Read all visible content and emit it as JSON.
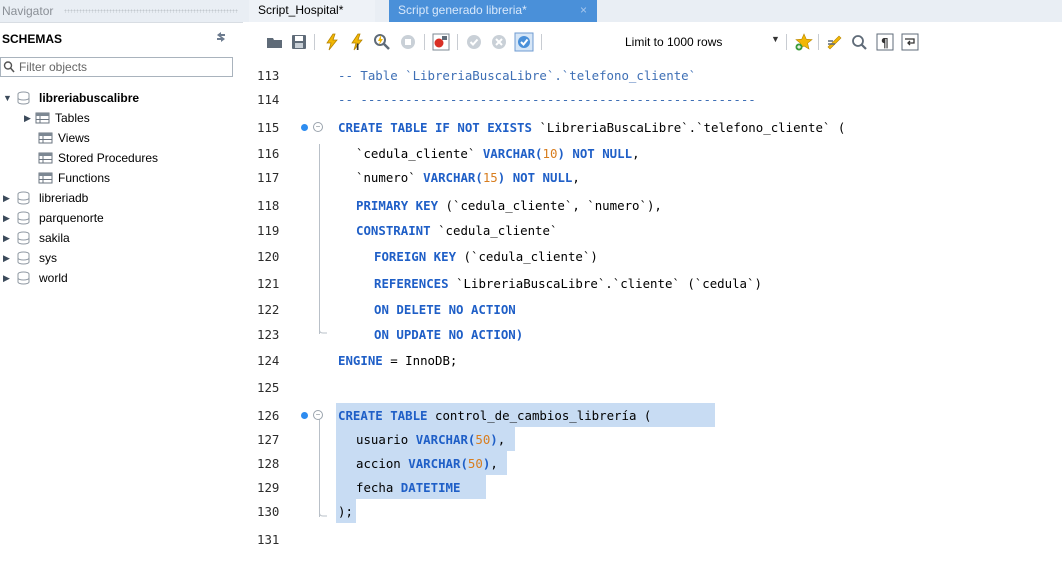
{
  "navigator": {
    "title": "Navigator",
    "schemas_label": "SCHEMAS",
    "filter_placeholder": "Filter objects",
    "tree": [
      {
        "label": "libreriabuscalibre",
        "expanded": true,
        "bold": true
      },
      {
        "label": "Tables"
      },
      {
        "label": "Views"
      },
      {
        "label": "Stored Procedures"
      },
      {
        "label": "Functions"
      },
      {
        "label": "libreriadb"
      },
      {
        "label": "parquenorte"
      },
      {
        "label": "sakila"
      },
      {
        "label": "sys"
      },
      {
        "label": "world"
      }
    ]
  },
  "tabs": [
    {
      "label": "Script_Hospital*",
      "active": false
    },
    {
      "label": "Script generado libreria*",
      "active": true,
      "close": "×"
    }
  ],
  "toolbar": {
    "limit_label": "Limit to 1000 rows",
    "icons": [
      "open-folder-icon",
      "save-icon",
      "execute-icon",
      "execute-current-icon",
      "explain-icon",
      "stop-icon",
      "toggle-error-icon",
      "commit-icon",
      "rollback-icon",
      "autocommit-icon",
      "limit-dropdown-icon",
      "add-snippet-icon",
      "beautify-icon",
      "find-icon",
      "invisible-chars-icon",
      "wrap-icon"
    ]
  },
  "colors": {
    "keyword": "#1f5fc7",
    "number": "#d87d1e",
    "selection": "#c8dcf3",
    "active_tab": "#4a90d9",
    "line_dot": "#2d8cf0"
  },
  "editor": {
    "lines": [
      {
        "n": "113",
        "text": "-- Table `LibreriaBuscaLibre`.`telefono_cliente`"
      },
      {
        "n": "114",
        "text": "-- -----------------------------------------------------"
      },
      {
        "n": "115",
        "text": "CREATE TABLE IF NOT EXISTS `LibreriaBuscaLibre`.`telefono_cliente` ("
      },
      {
        "n": "116",
        "text": "`cedula_cliente` VARCHAR(10) NOT NULL,"
      },
      {
        "n": "117",
        "text": "`numero` VARCHAR(15) NOT NULL,"
      },
      {
        "n": "118",
        "text": "PRIMARY KEY (`cedula_cliente`, `numero`),"
      },
      {
        "n": "119",
        "text": "CONSTRAINT `cedula_cliente`"
      },
      {
        "n": "120",
        "text": "FOREIGN KEY (`cedula_cliente`)"
      },
      {
        "n": "121",
        "text": "REFERENCES `LibreriaBuscaLibre`.`cliente` (`cedula`)"
      },
      {
        "n": "122",
        "text": "ON DELETE NO ACTION"
      },
      {
        "n": "123",
        "text": "ON UPDATE NO ACTION)"
      },
      {
        "n": "124",
        "text": "ENGINE = InnoDB;"
      },
      {
        "n": "125",
        "text": ""
      },
      {
        "n": "126",
        "text": "CREATE TABLE control_de_cambios_librería ("
      },
      {
        "n": "127",
        "text": "usuario VARCHAR(50),"
      },
      {
        "n": "128",
        "text": "accion VARCHAR(50),"
      },
      {
        "n": "129",
        "text": "fecha DATETIME"
      },
      {
        "n": "130",
        "text": ");"
      },
      {
        "n": "131",
        "text": ""
      }
    ]
  }
}
